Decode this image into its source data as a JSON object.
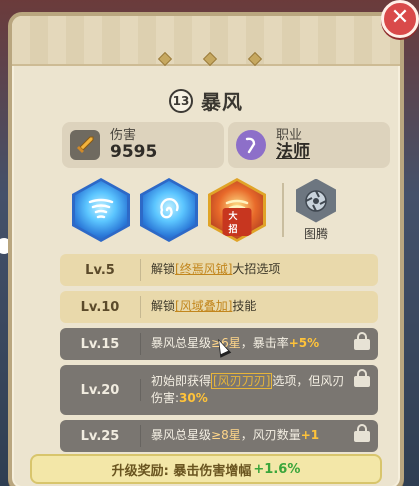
{
  "skill": {
    "level": "13",
    "name": "暴风"
  },
  "stats": {
    "damage": {
      "label": "伤害",
      "value": "9595"
    },
    "class": {
      "label": "职业",
      "value": "法师"
    }
  },
  "skill_icons": [
    {
      "icon": "tornado-icon",
      "color": "#2d69c7"
    },
    {
      "icon": "vortex-icon",
      "color": "#2d69c7"
    },
    {
      "icon": "ultimate-tornado-icon",
      "color": "#e0a428",
      "tag": "大招"
    }
  ],
  "totem": {
    "label": "图腾",
    "icon": "totem-sawblade-icon"
  },
  "upgrades": [
    {
      "level": "Lv.5",
      "parts": [
        "解锁",
        "[终焉风钺]",
        "大招选项"
      ],
      "locked": false
    },
    {
      "level": "Lv.10",
      "parts": [
        "解锁",
        "[风域叠加]",
        "技能"
      ],
      "locked": false
    },
    {
      "level": "Lv.15",
      "parts": [
        "暴风总星级",
        "≥6星",
        "，暴击率",
        "+5%"
      ],
      "locked": true
    },
    {
      "level": "Lv.20",
      "parts": [
        "初始即获得",
        "[风刃刀刃]",
        "选项，但风刃伤害:",
        "30%"
      ],
      "locked": true
    },
    {
      "level": "Lv.25",
      "parts": [
        "暴风总星级",
        "≥8星",
        "，风刃数量",
        "+1"
      ],
      "locked": true
    }
  ],
  "reward": {
    "label": "升级奖励: 暴击伤害增幅",
    "value": "+1.6%"
  },
  "colors": {
    "panel": "#ece4cf",
    "unlocked_row": "#e9d9ab",
    "locked_row": "#7a7671",
    "highlight": "#ffc33a",
    "close_button": "#d94a4a"
  }
}
